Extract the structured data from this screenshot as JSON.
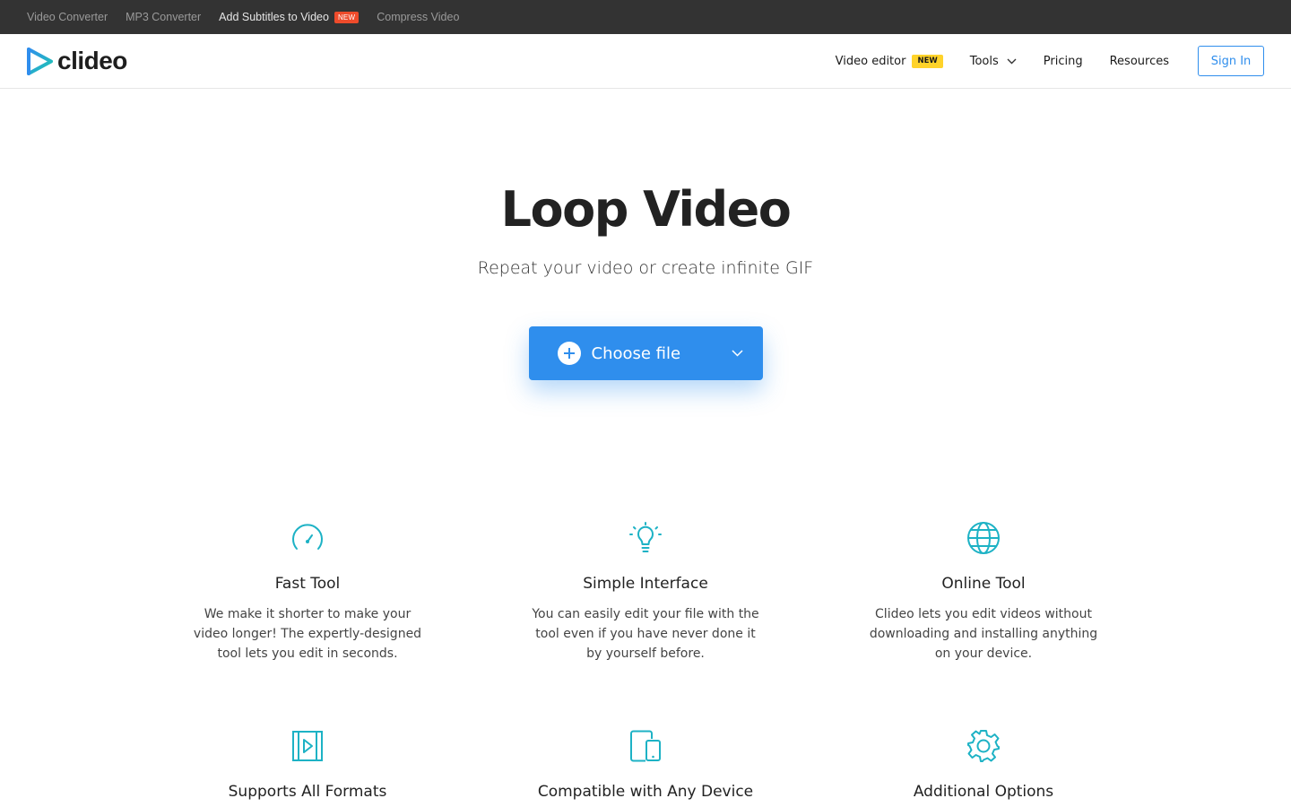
{
  "topbar": {
    "links": [
      {
        "label": "Video Converter",
        "active": false
      },
      {
        "label": "MP3 Converter",
        "active": false
      },
      {
        "label": "Add Subtitles to Video",
        "active": true,
        "badge": "NEW"
      },
      {
        "label": "Compress Video",
        "active": false
      }
    ]
  },
  "header": {
    "logo_text": "clideo",
    "nav": {
      "video_editor": "Video editor",
      "video_editor_badge": "NEW",
      "tools": "Tools",
      "pricing": "Pricing",
      "resources": "Resources"
    },
    "sign_in": "Sign In"
  },
  "hero": {
    "title": "Loop Video",
    "subtitle": "Repeat your video or create infinite GIF",
    "choose_file": "Choose file"
  },
  "features": [
    {
      "icon": "speedometer-icon",
      "title": "Fast Tool",
      "text": "We make it shorter to make your video longer! The expertly-designed tool lets you edit in seconds."
    },
    {
      "icon": "lightbulb-icon",
      "title": "Simple Interface",
      "text": "You can easily edit your file with the tool even if you have never done it by yourself before."
    },
    {
      "icon": "globe-icon",
      "title": "Online Tool",
      "text": "Clideo lets you edit videos without downloading and installing anything on your device."
    },
    {
      "icon": "video-file-icon",
      "title": "Supports All Formats",
      "text": ""
    },
    {
      "icon": "devices-icon",
      "title": "Compatible with Any Device",
      "text": ""
    },
    {
      "icon": "gear-icon",
      "title": "Additional Options",
      "text": ""
    }
  ],
  "colors": {
    "accent": "#2f8eed",
    "icon_teal": "#1db2c5",
    "topbar_bg": "#333333",
    "new_badge_red": "#ee4b2b",
    "new_badge_yellow": "#ffd32a"
  }
}
